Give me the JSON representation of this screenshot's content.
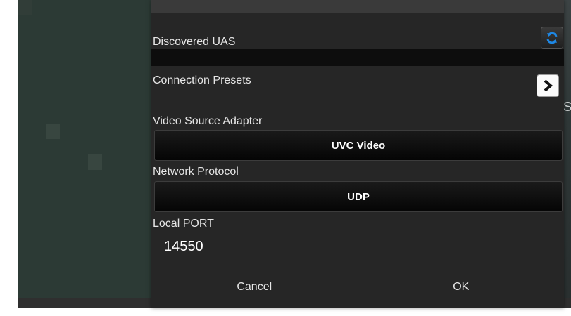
{
  "dialog": {
    "discovered_label": "Discovered UAS",
    "presets_label": "Connection Presets",
    "video_source_label": "Video Source Adapter",
    "video_source_value": "UVC Video",
    "protocol_label": "Network Protocol",
    "protocol_value": "UDP",
    "port_label": "Local PORT",
    "port_value": "14550",
    "cancel_label": "Cancel",
    "ok_label": "OK"
  },
  "icons": {
    "refresh": "refresh-icon",
    "next": "chevron-right-icon"
  },
  "background": {
    "partial_text": "S"
  },
  "colors": {
    "dialog_bg": "#262626",
    "accent_blue": "#1e88e5",
    "text": "#e6e6e6"
  }
}
